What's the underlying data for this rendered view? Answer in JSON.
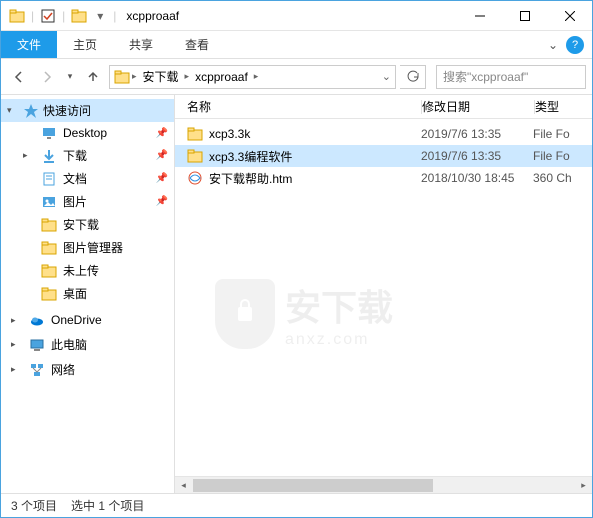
{
  "window": {
    "title": "xcpproaaf"
  },
  "ribbon": {
    "file": "文件",
    "tabs": [
      "主页",
      "共享",
      "查看"
    ]
  },
  "breadcrumb": {
    "items": [
      "安下载",
      "xcpproaaf"
    ]
  },
  "search": {
    "placeholder": "搜索\"xcpproaaf\""
  },
  "columns": {
    "name": "名称",
    "date": "修改日期",
    "type": "类型"
  },
  "sidebar": {
    "quick_access": "快速访问",
    "items": [
      {
        "label": "Desktop",
        "pinned": true,
        "icon": "desktop"
      },
      {
        "label": "下载",
        "pinned": true,
        "icon": "downloads",
        "expandable": true
      },
      {
        "label": "文档",
        "pinned": true,
        "icon": "documents"
      },
      {
        "label": "图片",
        "pinned": true,
        "icon": "pictures"
      },
      {
        "label": "安下载",
        "pinned": false,
        "icon": "folder"
      },
      {
        "label": "图片管理器",
        "pinned": false,
        "icon": "folder"
      },
      {
        "label": "未上传",
        "pinned": false,
        "icon": "folder"
      },
      {
        "label": "桌面",
        "pinned": false,
        "icon": "folder"
      }
    ],
    "roots": [
      {
        "label": "OneDrive",
        "icon": "onedrive",
        "expandable": true
      },
      {
        "label": "此电脑",
        "icon": "thispc",
        "expandable": true
      },
      {
        "label": "网络",
        "icon": "network",
        "expandable": true
      }
    ]
  },
  "files": [
    {
      "name": "xcp3.3k",
      "date": "2019/7/6 13:35",
      "type": "File Fo",
      "icon": "folder",
      "selected": false
    },
    {
      "name": "xcp3.3编程软件",
      "date": "2019/7/6 13:35",
      "type": "File Fo",
      "icon": "folder",
      "selected": true
    },
    {
      "name": "安下载帮助.htm",
      "date": "2018/10/30 18:45",
      "type": "360 Ch",
      "icon": "htm",
      "selected": false
    }
  ],
  "status": {
    "count": "3 个项目",
    "selection": "选中 1 个项目"
  },
  "watermark": {
    "big": "安下载",
    "small": "anxz.com"
  }
}
